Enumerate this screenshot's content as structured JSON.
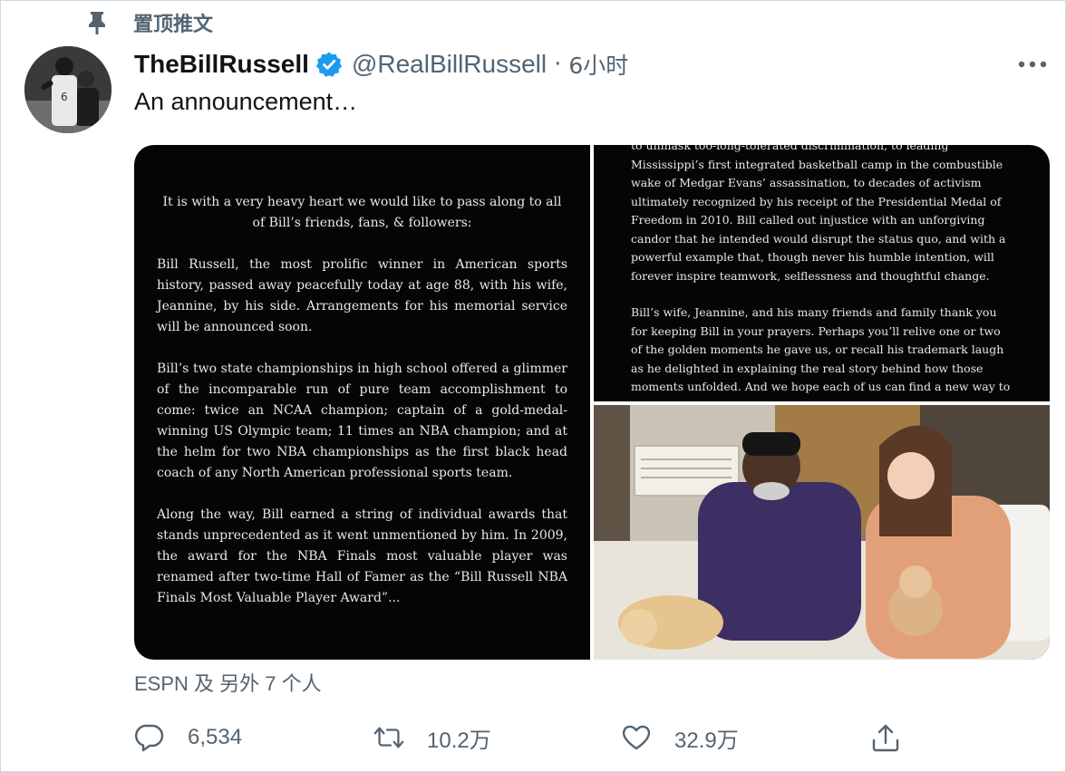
{
  "pinned": {
    "label": "置顶推文",
    "icon": "pin-icon"
  },
  "author": {
    "name": "TheBillRussell",
    "handle": "@RealBillRussell",
    "separator": "·",
    "time": "6小时",
    "verified_color": "#1d9bf0"
  },
  "tweet": {
    "text": "An announcement…"
  },
  "media": {
    "left_panel_paragraphs": [
      "It is with a very heavy heart we would like to pass along to all of Bill’s friends, fans, & followers:",
      "Bill Russell, the most prolific winner in American sports history, passed away peacefully today at age 88, with his wife, Jeannine, by his side. Arrangements for his memorial service will be announced soon.",
      "Bill’s two state championships in high school offered a glimmer of the incomparable run of pure team accomplishment to come: twice an NCAA champion; captain of a gold-medal-winning US Olympic team; 11 times an NBA champion; and at the helm for two NBA championships as the first black head coach of any North American professional sports team.",
      "Along the way, Bill earned a string of individual awards that stands unprecedented as it went unmentioned by him. In 2009, the award for the NBA Finals most valuable player was renamed after two-time Hall of Famer as the “Bill Russell NBA Finals Most Valuable Player Award”..."
    ],
    "right_panel_paragraphs": [
      "to unmask too-long-tolerated discrimination, to leading Mississippi’s first integrated basketball camp in the combustible wake of Medgar Evans’ assassination, to decades of activism ultimately recognized by his receipt of the Presidential Medal of Freedom in 2010. Bill called out injustice with an unforgiving candor that he intended would disrupt the status quo, and with a powerful example that, though never his humble intention, will forever inspire teamwork, selflessness and thoughtful change.",
      "Bill’s wife, Jeannine, and his many friends and family thank you for keeping Bill in your prayers. Perhaps you’ll relive one or two of the golden moments he gave us, or recall his trademark laugh as he delighted in explaining the real story behind how those moments unfolded. And we hope each of us can find a new way to act or speak up with Bill’s unwavering, dignified and"
    ]
  },
  "liked_by": "ESPN 及 另外 7 个人",
  "actions": {
    "reply_count": "6,534",
    "retweet_count": "10.2万",
    "like_count": "32.9万"
  }
}
